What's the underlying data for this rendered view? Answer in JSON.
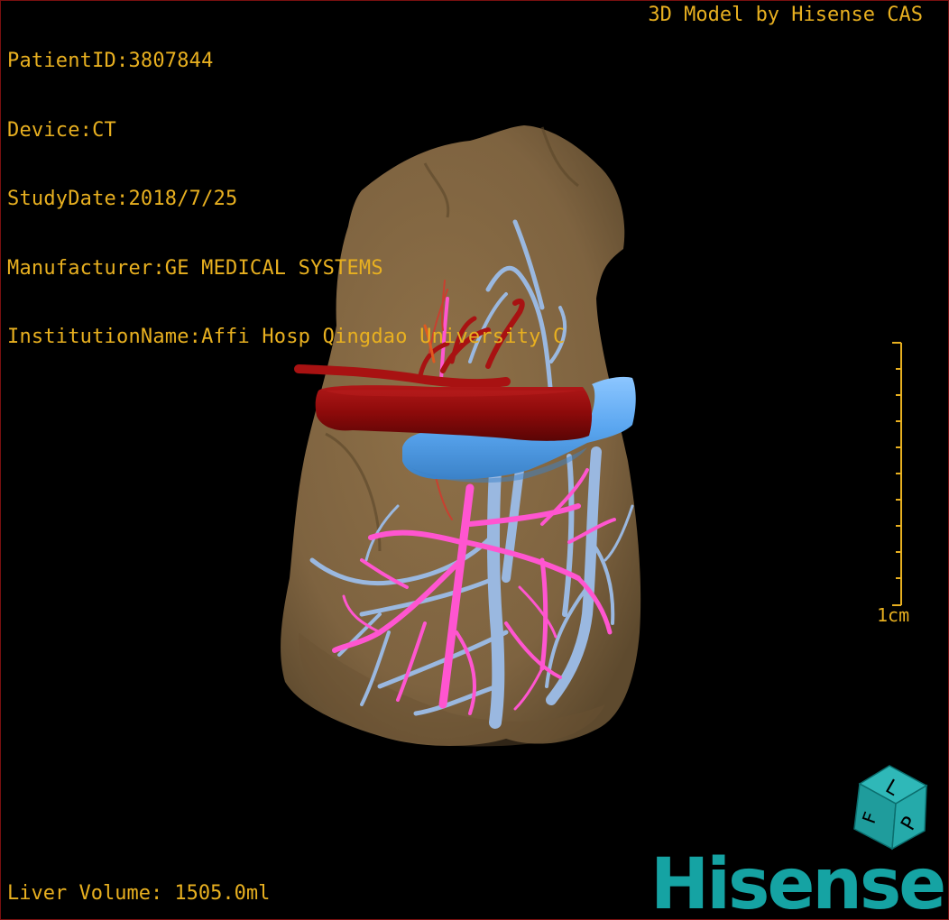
{
  "overlay": {
    "patient_id": "PatientID:3807844",
    "device": "Device:CT",
    "study_date": "StudyDate:2018/7/25",
    "manufacturer": "Manufacturer:GE MEDICAL SYSTEMS",
    "institution": "InstitutionName:Affi Hosp Qingdao University C",
    "credit": "3D Model by Hisense CAS",
    "liver_volume": "Liver Volume: 1505.0ml"
  },
  "scale": {
    "label": "1cm"
  },
  "orientation_cube": {
    "face_top": "L",
    "face_left": "F",
    "face_right": "P"
  },
  "brand": {
    "logo_text": "Hisense"
  },
  "colors": {
    "overlay_text": "#e8b020",
    "liver": "#8b6e45",
    "artery": "#8c0a0a",
    "portal_vein": "#ff55d0",
    "hepatic_vein": "#9ab8e0",
    "ivc": "#5aa6f0",
    "brand": "#15a3a3",
    "frame": "#7a1010"
  }
}
